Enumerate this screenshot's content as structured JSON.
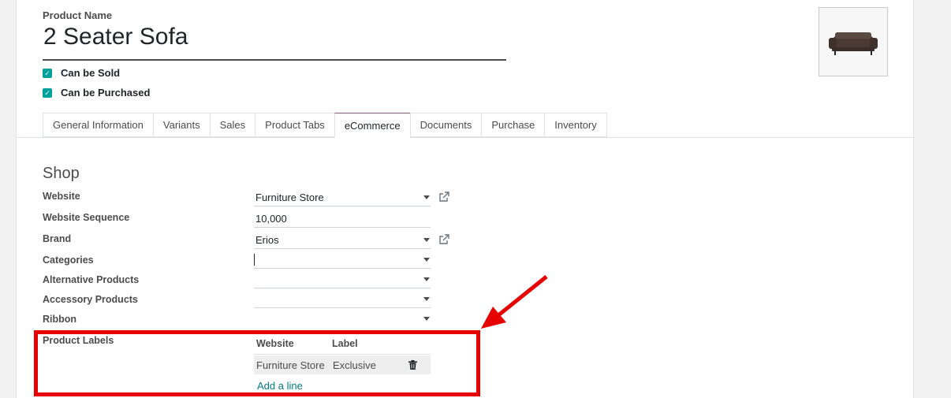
{
  "product": {
    "name_label": "Product Name",
    "name": "2 Seater Sofa",
    "can_be_sold_label": "Can be Sold",
    "can_be_sold": true,
    "can_be_purchased_label": "Can be Purchased",
    "can_be_purchased": true,
    "image_icon": "sofa-image"
  },
  "tabs": [
    {
      "label": "General Information"
    },
    {
      "label": "Variants"
    },
    {
      "label": "Sales"
    },
    {
      "label": "Product Tabs"
    },
    {
      "label": "eCommerce",
      "active": true
    },
    {
      "label": "Documents"
    },
    {
      "label": "Purchase"
    },
    {
      "label": "Inventory"
    }
  ],
  "shop": {
    "title": "Shop",
    "website_label": "Website",
    "website_value": "Furniture Store",
    "sequence_label": "Website Sequence",
    "sequence_value": "10,000",
    "brand_label": "Brand",
    "brand_value": "Erios",
    "categories_label": "Categories",
    "categories_value": "",
    "alternative_label": "Alternative Products",
    "alternative_value": "",
    "accessory_label": "Accessory Products",
    "accessory_value": "",
    "ribbon_label": "Ribbon",
    "ribbon_value": "",
    "labels_label": "Product Labels",
    "labels_table": {
      "headers": [
        "Website",
        "Label"
      ],
      "rows": [
        {
          "website": "Furniture Store",
          "label": "Exclusive"
        }
      ],
      "add_line": "Add a line",
      "delete_icon": "trash-icon"
    }
  },
  "colors": {
    "accent": "#00a09d",
    "tab_active": "#875a7b",
    "link": "#017e84",
    "annotation": "#e60000"
  }
}
